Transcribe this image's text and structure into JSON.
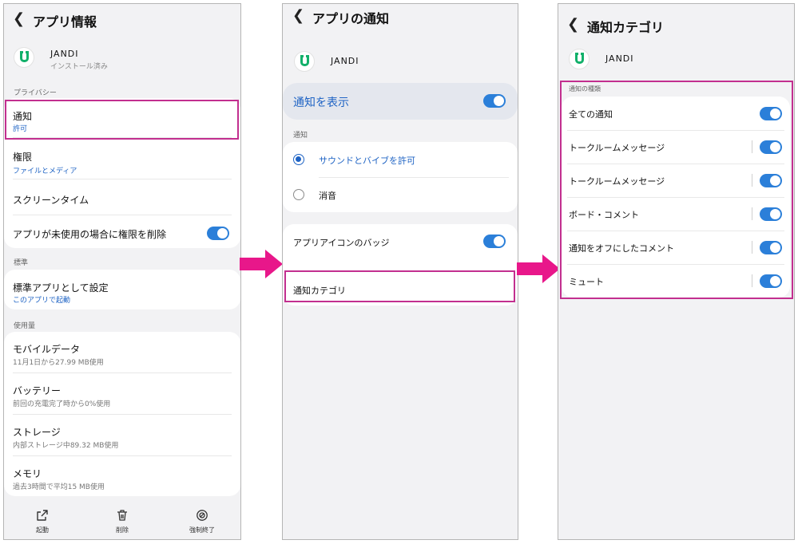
{
  "colors": {
    "accent": "#2b7fd9",
    "highlight": "#c22f8f",
    "arrow": "#e8178a",
    "brand_green": "#12b06a"
  },
  "panel1": {
    "title": "アプリ情報",
    "app_name": "JANDI",
    "app_status": "インストール済み",
    "privacy_header": "プライバシー",
    "notification": {
      "title": "通知",
      "value": "許可"
    },
    "permissions": {
      "title": "権限",
      "value": "ファイルとメディア"
    },
    "screen_time": "スクリーンタイム",
    "remove_permissions": "アプリが未使用の場合に権限を削除",
    "default_header": "標準",
    "default_app": {
      "title": "標準アプリとして設定",
      "value": "このアプリで起動"
    },
    "usage_header": "使用量",
    "mobile_data": {
      "title": "モバイルデータ",
      "value": "11月1日から27.99 MB使用"
    },
    "battery": {
      "title": "バッテリー",
      "value": "前回の充電完了時から0%使用"
    },
    "storage": {
      "title": "ストレージ",
      "value": "内部ストレージ中89.32 MB使用"
    },
    "memory": {
      "title": "メモリ",
      "value": "過去3時間で平均15 MB使用"
    },
    "bottom": {
      "open": "起動",
      "delete": "削除",
      "force_stop": "強制終了"
    }
  },
  "panel2": {
    "title": "アプリの通知",
    "app_name": "JANDI",
    "show_notifications": "通知を表示",
    "notification_header": "通知",
    "sound_vibrate": "サウンドとバイブを許可",
    "silent": "消音",
    "app_icon_badge": "アプリアイコンのバッジ",
    "notification_categories": "通知カテゴリ"
  },
  "panel3": {
    "title": "通知カテゴリ",
    "app_name": "JANDI",
    "types_header": "通知の種類",
    "items": [
      {
        "label": "全ての通知"
      },
      {
        "label": "トークルームメッセージ"
      },
      {
        "label": "トークルームメッセージ"
      },
      {
        "label": "ボード・コメント"
      },
      {
        "label": "通知をオフにしたコメント"
      },
      {
        "label": "ミュート"
      }
    ]
  }
}
